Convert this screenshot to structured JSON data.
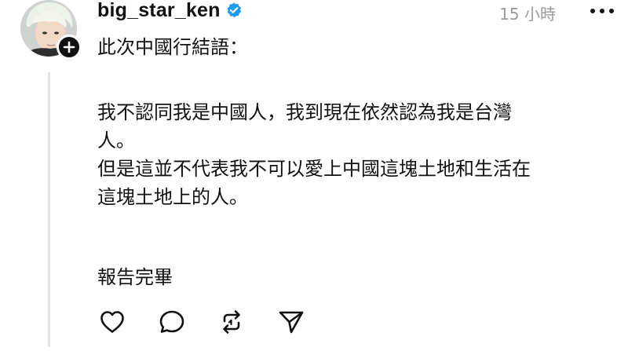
{
  "post": {
    "username": "big_star_ken",
    "verified": true,
    "timestamp": "15 小時",
    "lines": {
      "intro": "此次中國行結語：",
      "p1_l1": "我不認同我是中國人，我到現在依然認為我是台灣",
      "p1_l2": "人。",
      "p2_l1": "但是這並不代表我不可以愛上中國這塊土地和生活在",
      "p2_l2": "這塊土地上的人。",
      "closing": "報告完畢"
    }
  },
  "icons": {
    "verified": "verified-badge-icon",
    "follow": "plus-icon",
    "more": "more-horizontal-icon",
    "like": "heart-icon",
    "comment": "comment-bubble-icon",
    "repost": "repost-icon",
    "share": "send-icon"
  },
  "colors": {
    "verified_blue": "#1d9bf0",
    "text": "#111111",
    "muted": "#9a9a9a",
    "thread_line": "#e3e3e3"
  }
}
